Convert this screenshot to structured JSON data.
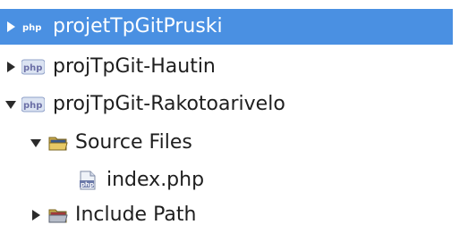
{
  "tree": {
    "selection_color": "#4a90e2",
    "nodes": [
      {
        "label": "projetTpGitPruski",
        "icon": "php-project-icon",
        "expanded": false,
        "selected": true
      },
      {
        "label": "projTpGit-Hautin",
        "icon": "php-project-icon",
        "expanded": false,
        "selected": false
      },
      {
        "label": "projTpGit-Rakotoarivelo",
        "icon": "php-project-icon",
        "expanded": true,
        "selected": false,
        "children": [
          {
            "label": "Source Files",
            "icon": "source-folder-icon",
            "expanded": true,
            "children": [
              {
                "label": "index.php",
                "icon": "php-file-icon"
              }
            ]
          },
          {
            "label": "Include Path",
            "icon": "include-path-folder-icon",
            "expanded": false
          }
        ]
      }
    ]
  }
}
